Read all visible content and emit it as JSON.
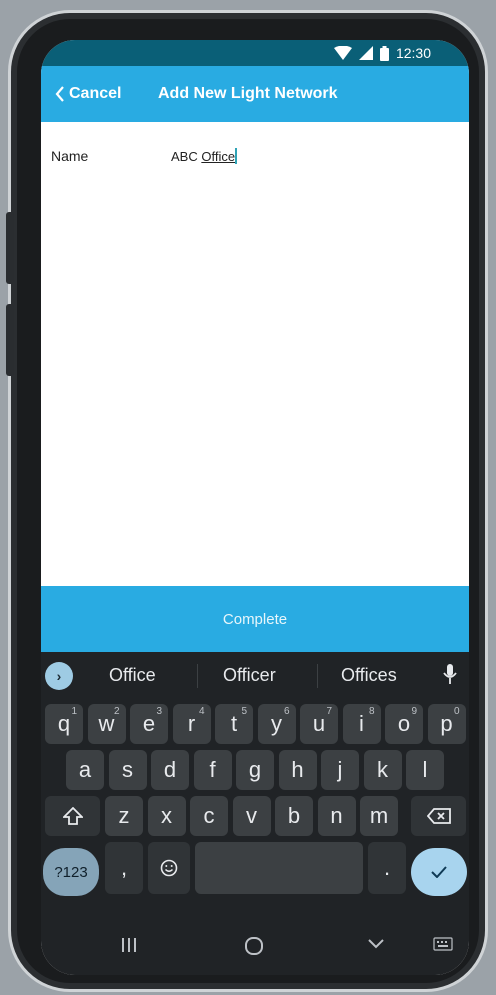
{
  "status_bar": {
    "time": "12:30"
  },
  "header": {
    "cancel_label": "Cancel",
    "title": "Add New Light Network"
  },
  "form": {
    "name_label": "Name",
    "name_value_prefix": "ABC ",
    "name_value_word": "Office"
  },
  "complete_label": "Complete",
  "keyboard": {
    "suggestions": [
      "Office",
      "Officer",
      "Offices"
    ],
    "row1": [
      {
        "k": "q",
        "h": "1"
      },
      {
        "k": "w",
        "h": "2"
      },
      {
        "k": "e",
        "h": "3"
      },
      {
        "k": "r",
        "h": "4"
      },
      {
        "k": "t",
        "h": "5"
      },
      {
        "k": "y",
        "h": "6"
      },
      {
        "k": "u",
        "h": "7"
      },
      {
        "k": "i",
        "h": "8"
      },
      {
        "k": "o",
        "h": "9"
      },
      {
        "k": "p",
        "h": "0"
      }
    ],
    "row2": [
      "a",
      "s",
      "d",
      "f",
      "g",
      "h",
      "j",
      "k",
      "l"
    ],
    "row3": [
      "z",
      "x",
      "c",
      "v",
      "b",
      "n",
      "m"
    ],
    "num_key": "?123",
    "comma_key": ",",
    "period_key": "."
  },
  "colors": {
    "accent": "#29abe2",
    "status_bar": "#0a5f77",
    "keyboard_bg": "#202326"
  },
  "icons": [
    "wifi-icon",
    "signal-icon",
    "battery-icon",
    "chevron-left-icon",
    "expand-icon",
    "mic-icon",
    "shift-icon",
    "backspace-icon",
    "emoji-icon",
    "check-icon",
    "recents-icon",
    "home-icon",
    "back-icon",
    "keyboard-icon"
  ]
}
